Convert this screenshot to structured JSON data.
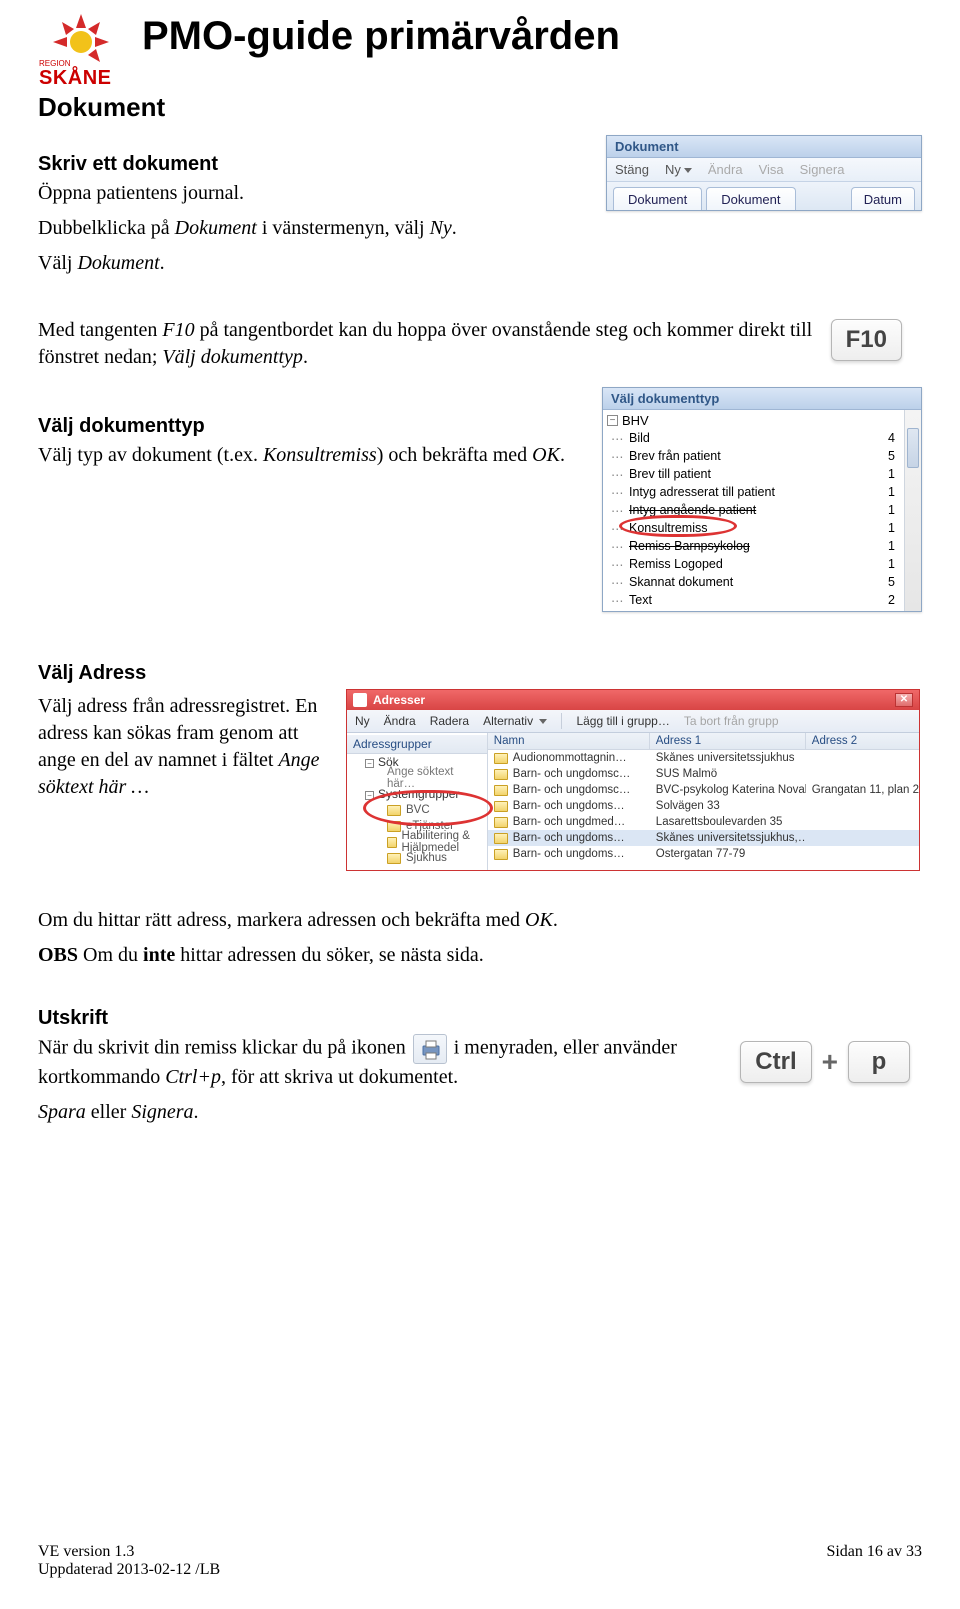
{
  "header": {
    "logo_top": "REGION",
    "logo_main": "SKÅNE",
    "main_title": "PMO-guide primärvården"
  },
  "section_title": "Dokument",
  "skriv": {
    "heading": "Skriv ett dokument",
    "p1": "Öppna patientens journal.",
    "p2a": "Dubbelklicka på ",
    "p2b_italic": "Dokument",
    "p2c": " i vänstermenyn, välj ",
    "p2d_italic": "Ny",
    "p2e": ".",
    "p3a": "Välj ",
    "p3b_italic": "Dokument",
    "p3c": "."
  },
  "pmo_toolbar": {
    "title": "Dokument",
    "items": [
      {
        "label": "Stäng",
        "disabled": false
      },
      {
        "label": "Ny",
        "disabled": false,
        "dropdown": true
      },
      {
        "label": "Ändra",
        "disabled": true
      },
      {
        "label": "Visa",
        "disabled": true
      },
      {
        "label": "Signera",
        "disabled": true
      }
    ],
    "tab_left1": "Dokument",
    "tab_left2": "Dokument",
    "tab_right": "Datum"
  },
  "f10": {
    "p_a": "Med tangenten ",
    "p_b_italic": "F10",
    "p_c": " på tangentbordet kan du hoppa över ovanstående steg och kommer direkt till fönstret nedan; ",
    "p_d_italic": "Välj dokumenttyp",
    "p_e": ".",
    "key_label": "F10"
  },
  "valj_dokumenttyp": {
    "heading": "Välj dokumenttyp",
    "p_a": "Välj typ av dokument (t.ex. ",
    "p_b_italic": "Konsultremiss",
    "p_c": ") och bekräfta med ",
    "p_d_italic": "OK",
    "p_e": "."
  },
  "doc_type_pane": {
    "title": "Välj dokumenttyp",
    "root": "BHV",
    "items": [
      {
        "label": "Bild",
        "count": "4"
      },
      {
        "label": "Brev från patient",
        "count": "5"
      },
      {
        "label": "Brev till patient",
        "count": "1"
      },
      {
        "label": "Intyg adresserat till patient",
        "count": "1"
      },
      {
        "label": "Intyg angående patient",
        "count": "1",
        "strike": true
      },
      {
        "label": "Konsultremiss",
        "count": "1",
        "highlight": true
      },
      {
        "label": "Remiss Barnpsykolog",
        "count": "1",
        "strike": true
      },
      {
        "label": "Remiss Logoped",
        "count": "1"
      },
      {
        "label": "Skannat dokument",
        "count": "5"
      },
      {
        "label": "Text",
        "count": "2"
      }
    ]
  },
  "valj_adress": {
    "heading": "Välj Adress",
    "p1a": "Välj adress från adressregistret. En adress kan sökas fram genom att ange en del av namnet i fältet ",
    "p1b_italic": "Ange söktext här …"
  },
  "adresser": {
    "title": "Adresser",
    "toolbar": {
      "ny": "Ny",
      "andra": "Ändra",
      "radera": "Radera",
      "alternativ": "Alternativ",
      "lagg_till": "Lägg till i grupp…",
      "ta_bort": "Ta bort från grupp"
    },
    "left": {
      "header": "Adressgrupper",
      "sok": "Sök",
      "sok_placeholder": "Ange söktext här…",
      "systemgrupper": "Systemgrupper",
      "items": [
        "BVC",
        "eTjänster",
        "Habilitering & Hjälpmedel",
        "Sjukhus"
      ]
    },
    "right": {
      "cols": {
        "c1": "Namn",
        "c2": "Adress 1",
        "c3": "Adress 2"
      },
      "rows": [
        {
          "c1": "Audionommottagnin…",
          "c2": "Skånes universitetssjukhus",
          "c3": ""
        },
        {
          "c1": "Barn- och ungdomsc…",
          "c2": "SUS Malmö",
          "c3": ""
        },
        {
          "c1": "Barn- och ungdomsc…",
          "c2": "BVC-psykolog Katerina Novak",
          "c3": "Grangatan 11, plan 2"
        },
        {
          "c1": "Barn- och ungdoms…",
          "c2": "Solvägen 33",
          "c3": ""
        },
        {
          "c1": "Barn- och ungdmed…",
          "c2": "Lasarettsboulevarden 35",
          "c3": ""
        },
        {
          "c1": "Barn- och ungdoms…",
          "c2": "Skånes universitetssjukhus,…",
          "c3": "",
          "sel": true
        },
        {
          "c1": "Barn- och ungdoms…",
          "c2": "Östergatan 77-79",
          "c3": ""
        }
      ]
    }
  },
  "after_addr": {
    "p1a": "Om du hittar rätt adress, markera adressen och bekräfta med ",
    "p1b_italic": "OK",
    "p1c": ".",
    "p2a": "OBS",
    "p2b": " Om du ",
    "p2c_bold": "inte",
    "p2d": " hittar adressen du söker, se nästa sida."
  },
  "utskrift": {
    "heading": "Utskrift",
    "p_a": "När du skrivit din remiss klickar du på ikonen ",
    "p_b": " i menyraden, eller använder kortkommando ",
    "p_c_italic": "Ctrl+p",
    "p_d": ", för att skriva ut dokumentet.",
    "key_ctrl": "Ctrl",
    "key_p": "p",
    "spara_a_italic": "Spara",
    "spara_mid": " eller ",
    "spara_b_italic": "Signera",
    "spara_end": "."
  },
  "footer": {
    "left1": "VE version 1.3",
    "left2": "Uppdaterad 2013-02-12 /LB",
    "right": "Sidan 16 av 33"
  }
}
